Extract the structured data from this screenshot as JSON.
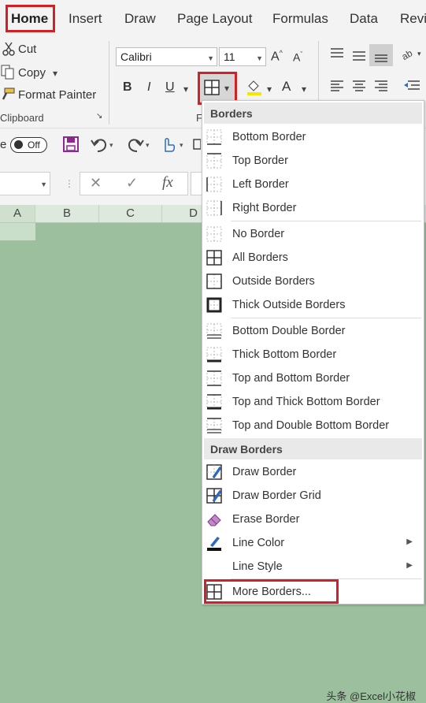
{
  "tabs": [
    "Home",
    "Insert",
    "Draw",
    "Page Layout",
    "Formulas",
    "Data",
    "Revi"
  ],
  "clipboard": {
    "cut": "Cut",
    "copy": "Copy",
    "format_painter": "Format Painter",
    "group_label": "Clipboard"
  },
  "font": {
    "name": "Calibri",
    "size": "11",
    "grow_glyph": "A",
    "bold": "B",
    "italic": "I",
    "underline": "U",
    "font_color_glyph": "A",
    "group_label_partial": "F"
  },
  "quick_access": {
    "autosave_partial": "e",
    "toggle_state": "Off"
  },
  "formula_bar": {
    "cancel": "✕",
    "enter": "✓",
    "function": "fx"
  },
  "columns": [
    "A",
    "B",
    "C",
    "D"
  ],
  "menu": {
    "header_borders": "Borders",
    "border_items": [
      "Bottom Border",
      "Top Border",
      "Left Border",
      "Right Border",
      "No Border",
      "All Borders",
      "Outside Borders",
      "Thick Outside Borders",
      "Bottom Double Border",
      "Thick Bottom Border",
      "Top and Bottom Border",
      "Top and Thick Bottom Border",
      "Top and Double Bottom Border"
    ],
    "header_draw": "Draw Borders",
    "draw_items": [
      "Draw Border",
      "Draw Border Grid",
      "Erase Border",
      "Line Color",
      "Line Style"
    ],
    "more": "More Borders..."
  },
  "watermark": "头条 @Excel小花椒",
  "colors": {
    "accent_red": "#d32027",
    "sheet_green": "#9cc09e",
    "ribbon_bg": "#f3f3f3"
  }
}
